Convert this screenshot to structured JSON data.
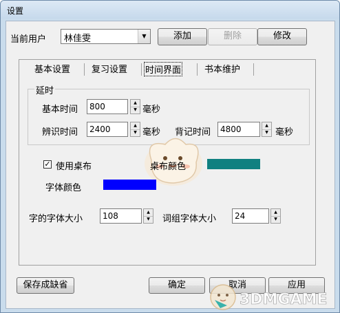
{
  "window": {
    "title": "设置"
  },
  "user_row": {
    "label": "当前用户",
    "selected_user": "林佳雯",
    "add_label": "添加",
    "delete_label": "删除",
    "modify_label": "修改"
  },
  "tabs": [
    {
      "label": "基本设置"
    },
    {
      "label": "复习设置"
    },
    {
      "label": "时间界面"
    },
    {
      "label": "书本维护"
    }
  ],
  "delay_group": {
    "title": "延时",
    "basic_time_label": "基本时间",
    "basic_time_value": "800",
    "recognize_time_label": "辨识时间",
    "recognize_time_value": "2400",
    "memorize_time_label": "背记时间",
    "memorize_time_value": "4800",
    "unit": "毫秒"
  },
  "appearance": {
    "use_tablecloth_label": "使用桌布",
    "use_tablecloth_checked": true,
    "tablecloth_color_label": "桌布颜色",
    "tablecloth_color": "#108080",
    "font_color_label": "字体颜色",
    "font_color": "#0000ff"
  },
  "font_sizes": {
    "char_font_label": "字的字体大小",
    "char_font_value": "108",
    "phrase_font_label": "词组字体大小",
    "phrase_font_value": "24"
  },
  "footer": {
    "save_default_label": "保存成缺省",
    "ok_label": "确定",
    "cancel_label": "取消",
    "apply_label": "应用"
  },
  "watermark": {
    "text": "3DMGAME"
  }
}
